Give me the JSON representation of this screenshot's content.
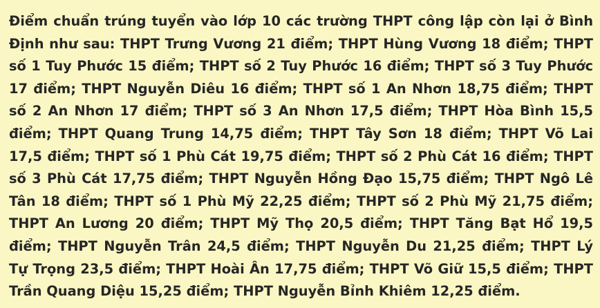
{
  "article": {
    "paragraph": "Điểm chuẩn trúng tuyển vào lớp 10 các trường THPT công lập còn lại ở Bình Định như sau: THPT Trưng Vương 21 điểm; THPT Hùng Vương 18 điểm; THPT số 1 Tuy Phước 15 điểm; THPT số 2 Tuy Phước 16 điểm; THPT số 3 Tuy Phước 17 điểm; THPT Nguyễn Diêu 16 điểm; THPT số 1 An Nhơn 18,75 điểm; THPT số 2 An Nhơn 17 điểm; THPT số 3 An Nhơn 17,5 điểm; THPT Hòa Bình 15,5 điểm; THPT Quang Trung 14,75 điểm; THPT Tây Sơn 18 điểm; THPT Võ Lai 17,5 điểm; THPT số 1 Phù Cát 19,75 điểm; THPT số 2 Phù Cát 16 điểm; THPT số 3 Phù Cát 17,75 điểm; THPT Nguyễn Hồng Đạo 15,75 điểm; THPT Ngô Lê Tân 18 điểm; THPT số 1 Phù Mỹ 22,25 điểm; THPT số 2 Phù Mỹ 21,75 điểm; THPT An Lương 20 điểm; THPT Mỹ Thọ 20,5 điểm; THPT Tăng Bạt Hổ 19,5 điểm; THPT Nguyễn Trân 24,5 điểm; THPT Nguyễn Du 21,25 điểm; THPT Lý Tự Trọng 23,5 điểm; THPT Hoài Ân 17,75 điểm; THPT Võ Giữ 15,5 điểm; THPT Trần Quang Diệu 15,25 điểm; THPT Nguyễn Bỉnh Khiêm 12,25 điểm."
  },
  "colors": {
    "background": "#fbf7c4",
    "text": "#262626"
  }
}
